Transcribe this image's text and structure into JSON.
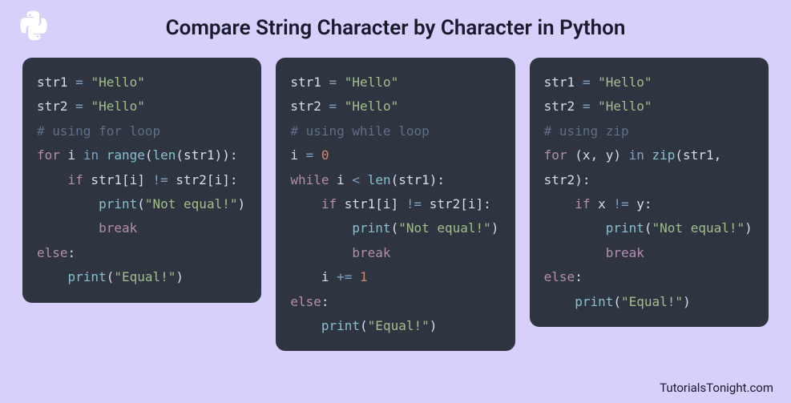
{
  "title": "Compare String Character by Character in Python",
  "footer": "TutorialsTonight.com",
  "panels": [
    {
      "comment": "# using for loop",
      "lines": {
        "l1a": "str1 ",
        "l1b": "=",
        "l1c": " \"Hello\"",
        "l2a": "str2 ",
        "l2b": "=",
        "l2c": " \"Hello\"",
        "l4a": "for",
        "l4b": " i ",
        "l4c": "in",
        "l4d": " range",
        "l4e": "(",
        "l4f": "len",
        "l4g": "(str1)):",
        "l5a": "    if",
        "l5b": " str1[i] ",
        "l5c": "!=",
        "l5d": " str2[i]:",
        "l6a": "        print",
        "l6b": "(",
        "l6c": "\"Not equal!\"",
        "l6d": ")",
        "l7a": "        break",
        "l8a": "else",
        "l8b": ":",
        "l9a": "    print",
        "l9b": "(",
        "l9c": "\"Equal!\"",
        "l9d": ")"
      }
    },
    {
      "comment": "# using while loop",
      "lines": {
        "l1a": "str1 ",
        "l1b": "=",
        "l1c": " \"Hello\"",
        "l2a": "str2 ",
        "l2b": "=",
        "l2c": " \"Hello\"",
        "l4a": "i ",
        "l4b": "=",
        "l4c": " 0",
        "l5a": "while",
        "l5b": " i ",
        "l5c": "<",
        "l5d": " len",
        "l5e": "(str1):",
        "l6a": "    if",
        "l6b": " str1[i] ",
        "l6c": "!=",
        "l6d": " str2[i]:",
        "l7a": "        print",
        "l7b": "(",
        "l7c": "\"Not equal!\"",
        "l7d": ")",
        "l8a": "        break",
        "l9a": "    i ",
        "l9b": "+=",
        "l9c": " 1",
        "l10a": "else",
        "l10b": ":",
        "l11a": "    print",
        "l11b": "(",
        "l11c": "\"Equal!\"",
        "l11d": ")"
      }
    },
    {
      "comment": "# using zip",
      "lines": {
        "l1a": "str1 ",
        "l1b": "=",
        "l1c": " \"Hello\"",
        "l2a": "str2 ",
        "l2b": "=",
        "l2c": " \"Hello\"",
        "l4a": "for",
        "l4b": " (x, y) ",
        "l4c": "in",
        "l4d": " zip",
        "l4e": "(str1,",
        "l4f": "str2):",
        "l5a": "    if",
        "l5b": " x ",
        "l5c": "!=",
        "l5d": " y:",
        "l6a": "        print",
        "l6b": "(",
        "l6c": "\"Not equal!\"",
        "l6d": ")",
        "l7a": "        break",
        "l8a": "else",
        "l8b": ":",
        "l9a": "    print",
        "l9b": "(",
        "l9c": "\"Equal!\"",
        "l9d": ")"
      }
    }
  ]
}
